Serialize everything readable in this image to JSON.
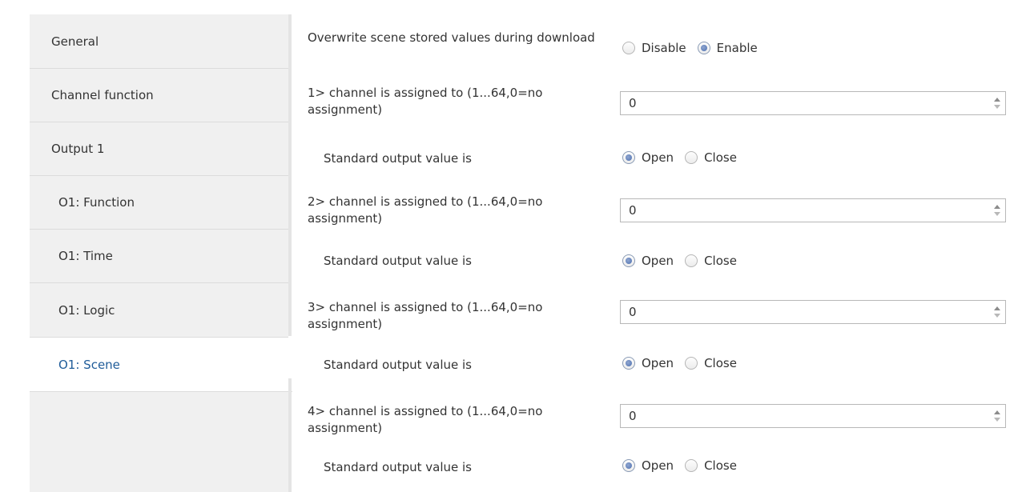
{
  "sidebar": {
    "items": [
      {
        "label": "General"
      },
      {
        "label": "Channel function"
      },
      {
        "label": "Output 1"
      },
      {
        "label": "O1: Function"
      },
      {
        "label": "O1: Time"
      },
      {
        "label": "O1: Logic"
      },
      {
        "label": "O1: Scene",
        "selected": true
      }
    ]
  },
  "params": {
    "overwrite": {
      "label": "Overwrite scene stored values during download",
      "options": [
        "Disable",
        "Enable"
      ],
      "selected": "Enable"
    },
    "channels": [
      {
        "label": "1> channel is assigned to (1...64,0=no assignment)",
        "value": "0",
        "std_label": "Standard output value is",
        "options": [
          "Open",
          "Close"
        ],
        "selected": "Open"
      },
      {
        "label": "2> channel is assigned to (1...64,0=no assignment)",
        "value": "0",
        "std_label": "Standard output value is",
        "options": [
          "Open",
          "Close"
        ],
        "selected": "Open"
      },
      {
        "label": "3> channel is assigned to (1...64,0=no assignment)",
        "value": "0",
        "std_label": "Standard output value is",
        "options": [
          "Open",
          "Close"
        ],
        "selected": "Open"
      },
      {
        "label": "4> channel is assigned to (1...64,0=no assignment)",
        "value": "0",
        "std_label": "Standard output value is",
        "options": [
          "Open",
          "Close"
        ],
        "selected": "Open"
      }
    ]
  },
  "colors": {
    "selected_text": "#1f5c99",
    "sidebar_bg": "#f0f0f0",
    "radio_dot": "#4d6fb0"
  },
  "icons": {
    "radio_checked": "radio-checked-icon",
    "radio_unchecked": "radio-unchecked-icon",
    "spin_up": "spin-up-icon",
    "spin_down": "spin-down-icon"
  }
}
